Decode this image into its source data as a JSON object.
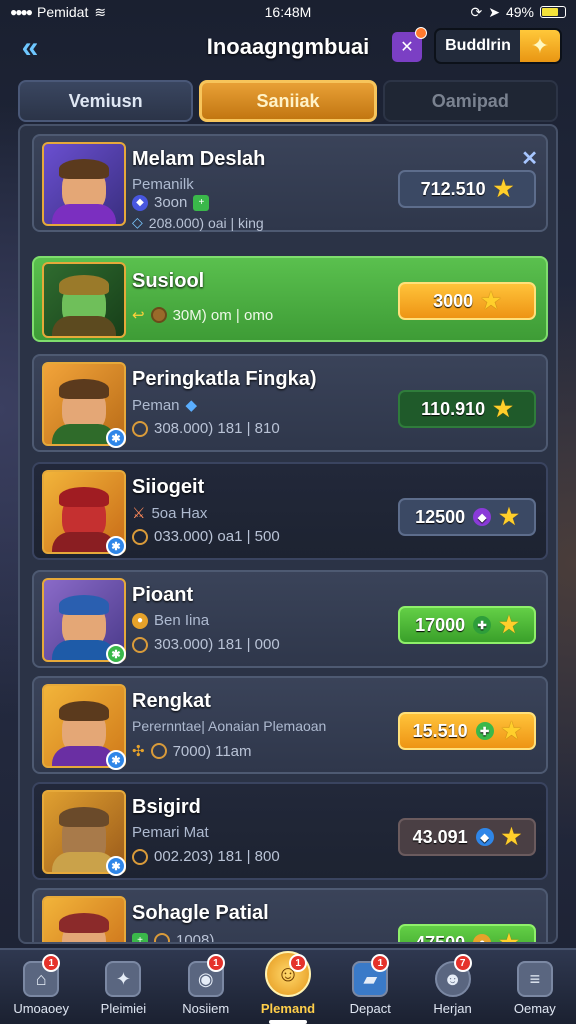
{
  "status_bar": {
    "carrier": "Pemidat",
    "time": "16:48M",
    "battery": "49%"
  },
  "header": {
    "title": "Inoaagngmbuai",
    "action_label": "Buddlrin"
  },
  "tabs": [
    {
      "label": "Vemiusn",
      "state": "normal"
    },
    {
      "label": "Saniiak",
      "state": "active"
    },
    {
      "label": "Oamipad",
      "state": "disabled"
    }
  ],
  "players": [
    {
      "name": "Melam Deslah",
      "sub": "Pemanilk",
      "stat": "3oon",
      "meta": "208.000) oai | king",
      "score": "712.510",
      "score_style": "gray",
      "card_style": "normal",
      "avatar_color": "#7b2fc0",
      "badge": ""
    },
    {
      "name": "Susiool",
      "sub": "",
      "stat": "",
      "meta": "30M) om | omo",
      "score": "3000",
      "score_style": "orange",
      "card_style": "highlight",
      "avatar_color": "#2e7d32",
      "badge": ""
    },
    {
      "name": "Peringkatla Fingka)",
      "sub": "Peman",
      "stat": "",
      "meta": "308.000) 181 | 810",
      "score": "110.910",
      "score_style": "darkgreen",
      "card_style": "normal",
      "avatar_color": "#c47a1f",
      "badge": "✱"
    },
    {
      "name": "Siiogeit",
      "sub": "",
      "stat": "5oa Hax",
      "meta": "033.000) oa1 | 500",
      "score": "12500",
      "score_style": "gray",
      "card_style": "dark",
      "avatar_color": "#b8202a",
      "badge": "✱"
    },
    {
      "name": "Pioant",
      "sub": "Ben Iina",
      "stat": "",
      "meta": "303.000) 181 | 000",
      "score": "17000",
      "score_style": "green",
      "card_style": "normal",
      "avatar_color": "#1e5ba8",
      "badge": "✱"
    },
    {
      "name": "Rengkat",
      "sub": "Perernntae| Aonaian Plemaoan",
      "stat": "",
      "meta": "7000) 11am",
      "score": "15.510",
      "score_style": "orange",
      "card_style": "normal",
      "avatar_color": "#6a2fa3",
      "badge": "✱"
    },
    {
      "name": "Bsigird",
      "sub": "Pemari Mat",
      "stat": "",
      "meta": "002.203) 181 | 800",
      "score": "43.091",
      "score_style": "brown",
      "card_style": "dark",
      "avatar_color": "#8b5a2b",
      "badge": "✱"
    },
    {
      "name": "Sohagle Patial",
      "sub": "",
      "stat": "",
      "meta": "1008) ....",
      "score": "47500",
      "score_style": "green",
      "card_style": "normal",
      "avatar_color": "#8b2a2a",
      "badge": ""
    }
  ],
  "bottom_nav": [
    {
      "label": "Umoaoey",
      "icon": "home-icon",
      "dot": "1"
    },
    {
      "label": "Pleimiei",
      "icon": "gear-icon",
      "dot": ""
    },
    {
      "label": "Nosiiem",
      "icon": "chat-icon",
      "dot": "1"
    },
    {
      "label": "Plemand",
      "icon": "trophy-icon",
      "dot": "1",
      "active": true
    },
    {
      "label": "Depact",
      "icon": "card-icon",
      "dot": "1"
    },
    {
      "label": "Herjan",
      "icon": "friends-icon",
      "dot": "7"
    },
    {
      "label": "Oemay",
      "icon": "menu-icon",
      "dot": ""
    }
  ]
}
